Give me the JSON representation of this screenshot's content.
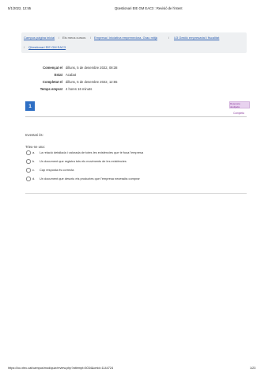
{
  "print_header": {
    "datetime": "5/1/2022, 12:55",
    "title": "Qüestionari EIE GM EAC3 : Revisió de l'intent"
  },
  "breadcrumb": {
    "items": [
      "Campus pàgina inicial",
      "Els meus cursos",
      "Empresa i iniciativa emprenedora. Grau mitjà",
      "U3 Gestió empresarial i fiscalitat",
      "Qüestionari EIE GM EAC3"
    ],
    "separator": "/"
  },
  "summary": [
    {
      "label": "Començat el",
      "value": "dilluns, 5 de desembre 2022, 08:38"
    },
    {
      "label": "Estat",
      "value": "Acabat"
    },
    {
      "label": "Completat el",
      "value": "dilluns, 5 de desembre 2022, 12:55"
    },
    {
      "label": "Temps emprat",
      "value": "4 hores 16 minuts"
    }
  ],
  "question": {
    "number": "1",
    "status_badge": "Resposta desitjada",
    "completion": "Completa",
    "prompt": "Inventari és:",
    "select_label": "Trieu-ne una:",
    "options": [
      {
        "letter": "a.",
        "text": "La relació detallada i valorada de totes les existències que té fusa l'empresa"
      },
      {
        "letter": "b.",
        "text": "Un document que registra tots els moviments de les existències"
      },
      {
        "letter": "c.",
        "text": "Cap resposta és correcta"
      },
      {
        "letter": "d.",
        "text": "Un document que descriu els productes que l'empresa necessita comprar"
      }
    ]
  },
  "print_footer": {
    "url": "https://ioc.xtec.cat/campus/mod/quiz/review.php?attempt=5034&cmid=1144724",
    "page": "1/23"
  },
  "colors": {
    "accent": "#2e6fc4",
    "badge_bg": "#e8d2ef",
    "badge_text": "#8a3a9c",
    "link": "#2a5db0"
  }
}
